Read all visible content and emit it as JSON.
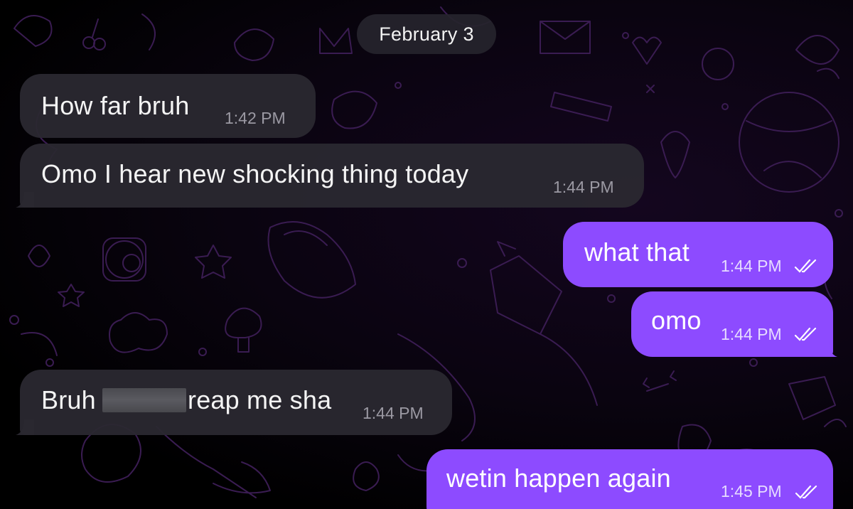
{
  "date_separator": "February 3",
  "messages": [
    {
      "direction": "incoming",
      "text": "How far bruh",
      "time": "1:42 PM"
    },
    {
      "direction": "incoming",
      "text": "Omo I hear new shocking thing today",
      "time": "1:44 PM"
    },
    {
      "direction": "outgoing",
      "text": "what that",
      "time": "1:44 PM",
      "status": "read"
    },
    {
      "direction": "outgoing",
      "text": "omo",
      "time": "1:44 PM",
      "status": "read"
    },
    {
      "direction": "incoming",
      "text_before_redaction": "Bruh",
      "text_after_redaction": "reap me sha",
      "time": "1:44 PM"
    },
    {
      "direction": "outgoing",
      "text": "wetin happen again",
      "time": "1:45 PM",
      "status": "read"
    }
  ],
  "colors": {
    "incoming_bubble": "#2a2830",
    "outgoing_bubble": "#8d4bff",
    "background": "#000000",
    "doodle_stroke": "#3a1d55"
  },
  "icons": {
    "read_receipt": "double-check-icon",
    "wallpaper": "doodle-pattern"
  }
}
